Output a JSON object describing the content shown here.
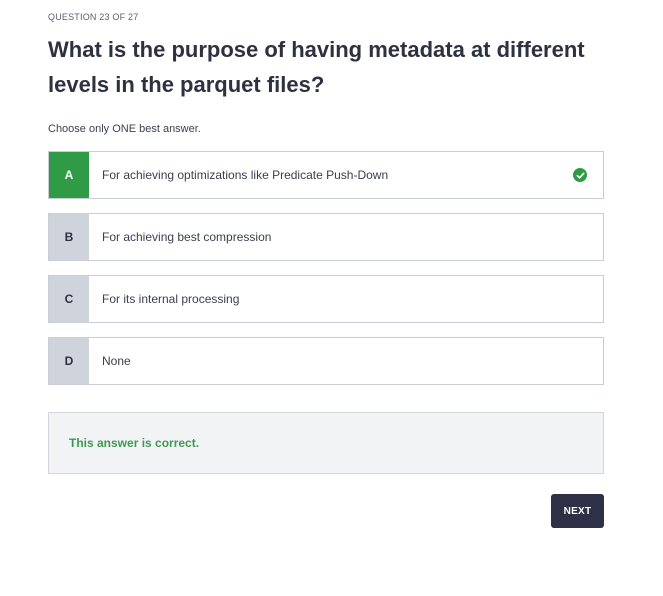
{
  "quiz": {
    "counter": "QUESTION 23 OF 27",
    "question": "What is the purpose of having metadata at different levels in the parquet files?",
    "instruction": "Choose only ONE best answer.",
    "options": [
      {
        "letter": "A",
        "text": "For achieving optimizations like Predicate Push-Down",
        "state": "correct"
      },
      {
        "letter": "B",
        "text": "For achieving best compression",
        "state": "unselected"
      },
      {
        "letter": "C",
        "text": "For its internal processing",
        "state": "unselected"
      },
      {
        "letter": "D",
        "text": "None",
        "state": "unselected"
      }
    ],
    "feedback": "This answer is correct.",
    "next_label": "NEXT"
  },
  "icons": {
    "correct_mark": "check-circle-icon"
  },
  "colors": {
    "correct": "#2f9b47",
    "letter_bg": "#cfd3dc",
    "button_bg": "#2e3045",
    "feedback_text": "#3e9a4f"
  }
}
